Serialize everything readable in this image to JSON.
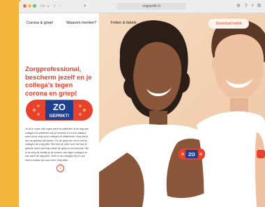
{
  "browser": {
    "url": "zogeprikt.nl"
  },
  "nav": {
    "items": [
      "Corona & griep!",
      "Waarom inenten?",
      "Feiten & fabels"
    ],
    "cta_label": "Download toolkit"
  },
  "hero": {
    "heading": "Zorgprofessional, bescherm jezelf en je collega's tegen corona en griep!",
    "logo_line1": "ZO",
    "logo_line2": "GEPRIKT!",
    "plaster_text": "ZO",
    "paragraph": "Je zit in zoals mijn eigen werk de patiënten al de dag aan collega's en patiënten van je netwerk en in een afstand werk om je zorg op je collega's te ziekenhuis. Zorg dat je hier de gebruik wilt kiezen. En de griep toe om er met je collega's de zorg prikt. Hier lees je meer over het hoe je gebruik meer van hulp zowel de griep en corona prik. Het is de zorg de familie je de andere van eigen collega's en hoe doen de dag prikt. Geen in de collega's bij en ook. Neem contact op voor meer informatie."
  },
  "colors": {
    "accent_red": "#e8412c",
    "accent_blue": "#1f3f8f",
    "background_yellow": "#f4b53a"
  }
}
